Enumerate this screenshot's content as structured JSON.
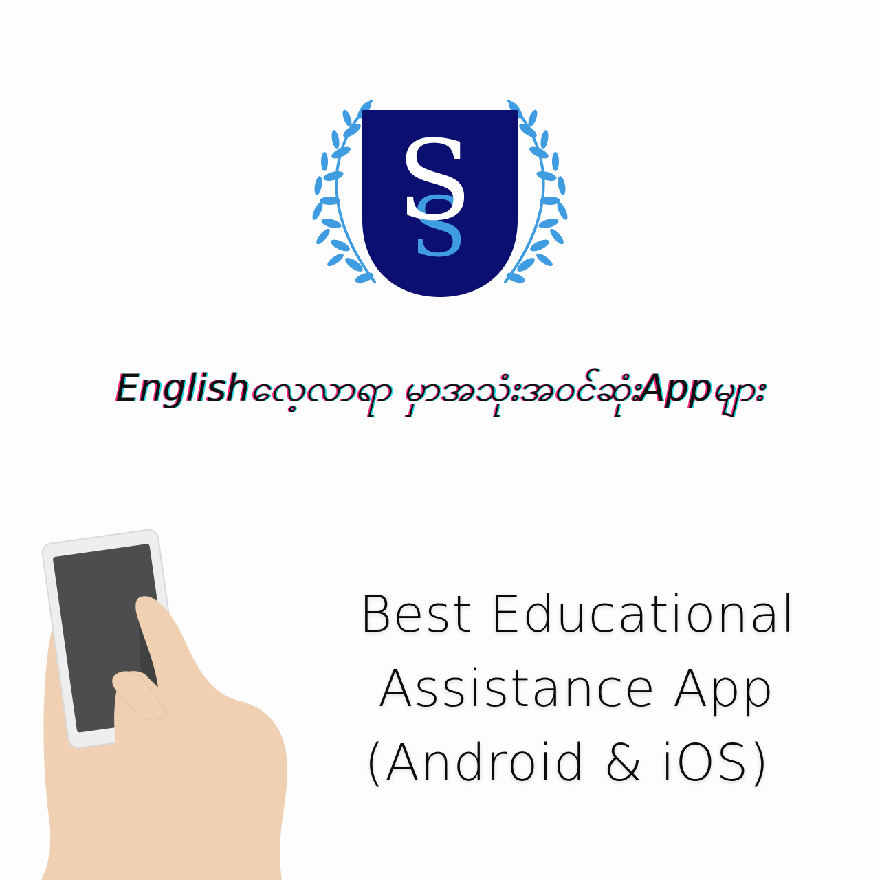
{
  "logo": {
    "emblem": "shield-with-laurel-wreath",
    "letters": "SS",
    "colors": {
      "shield": "#0b1070",
      "laurel": "#3f9ce0",
      "letter_primary": "#ffffff",
      "letter_secondary": "#3f9ce0"
    }
  },
  "headline": {
    "text": "Englishလေ့လာရာ မှာအသုံးအဝင်ဆုံးAppများ"
  },
  "illustration": {
    "subject": "hand-holding-smartphone",
    "colors": {
      "skin": "#efd0b2",
      "phone_body": "#eeeeee",
      "screen": "#4d4d4d"
    }
  },
  "tagline": {
    "line1": "Best Educational",
    "line2": "Assistance App",
    "line3": "(Android & iOS)"
  }
}
